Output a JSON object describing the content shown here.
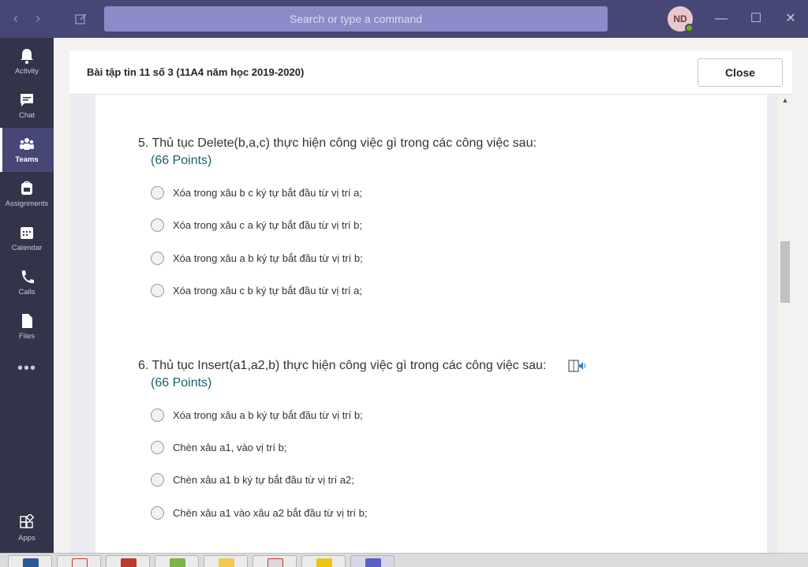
{
  "titlebar": {
    "search_placeholder": "Search or type a command",
    "avatar_initials": "ND",
    "back_icon": "chevron-left-icon",
    "forward_icon": "chevron-right-icon",
    "compose_icon": "compose-icon"
  },
  "rail": {
    "items": [
      {
        "label": "Activity",
        "icon": "bell-icon"
      },
      {
        "label": "Chat",
        "icon": "chat-icon"
      },
      {
        "label": "Teams",
        "icon": "teams-icon",
        "active": true
      },
      {
        "label": "Assignments",
        "icon": "backpack-icon"
      },
      {
        "label": "Calendar",
        "icon": "calendar-icon"
      },
      {
        "label": "Calls",
        "icon": "phone-icon"
      },
      {
        "label": "Files",
        "icon": "file-icon"
      }
    ],
    "more_label": "•••",
    "apps_label": "Apps"
  },
  "header": {
    "title": "Bài tập tin 11 số 3 (11A4 năm học 2019-2020)",
    "close_label": "Close"
  },
  "form": {
    "questions": [
      {
        "title": "5. Thủ tục Delete(b,a,c) thực hiện công việc gì trong các công việc sau:",
        "points": "(66 Points)",
        "options": [
          "Xóa trong xâu b c ký tự bắt đầu từ vị trí a;",
          "Xóa trong xâu c a ký tự bắt đầu từ vị trí b;",
          "Xóa trong xâu a b ký tự bắt đầu từ vị trí b;",
          "Xóa trong xâu c b ký tự bắt đầu từ vị trí a;"
        ]
      },
      {
        "title": "6. Thủ tục Insert(a1,a2,b) thực hiện công việc gì trong các công việc sau:",
        "points": "(66 Points)",
        "options": [
          "Xóa trong xâu a b ký tự bắt đầu từ vị trí b;",
          "Chèn xâu a1, vào vị trí b;",
          "Chèn xâu a1 b ký tự bắt đầu từ vị trí a2;",
          "Chèn xâu a1 vào xâu a2 bắt đầu từ vị trí b;"
        ]
      }
    ]
  },
  "colors": {
    "titlebar": "#464775",
    "rail": "#33344a",
    "points": "#1b5f6b",
    "search": "#8b8cc7"
  }
}
